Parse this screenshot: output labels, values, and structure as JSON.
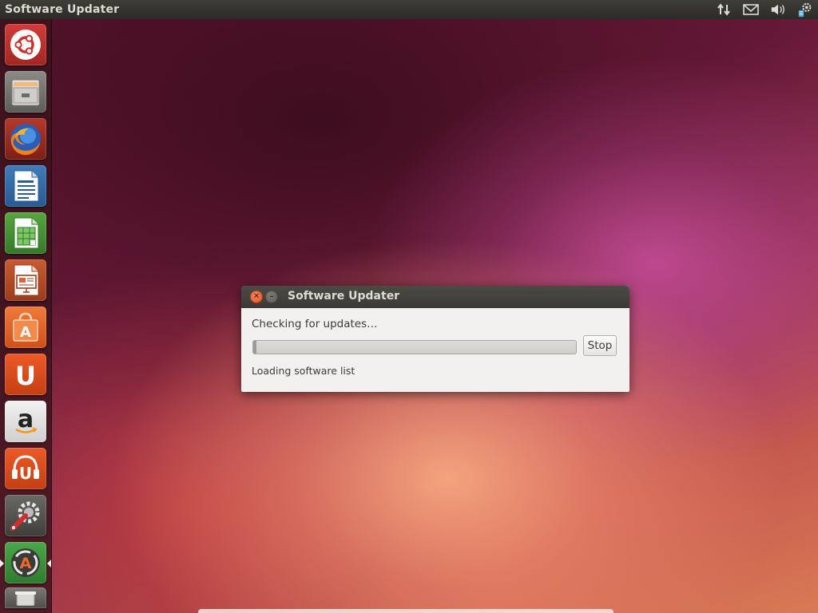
{
  "top_panel": {
    "title": "Software Updater",
    "indicators": [
      "network-icon",
      "mail-icon",
      "volume-icon",
      "settings-icon"
    ]
  },
  "launcher": {
    "items": [
      {
        "name": "dash-home",
        "icon": "ubuntu-logo-icon"
      },
      {
        "name": "files",
        "icon": "file-cabinet-icon"
      },
      {
        "name": "firefox",
        "icon": "firefox-icon"
      },
      {
        "name": "libreoffice-writer",
        "icon": "writer-doc-icon"
      },
      {
        "name": "libreoffice-calc",
        "icon": "calc-sheet-icon"
      },
      {
        "name": "libreoffice-impress",
        "icon": "impress-slide-icon"
      },
      {
        "name": "ubuntu-software-center",
        "icon": "shopping-bag-icon"
      },
      {
        "name": "ubuntu-one",
        "icon": "ubuntu-one-icon"
      },
      {
        "name": "amazon",
        "icon": "amazon-icon"
      },
      {
        "name": "ubuntu-one-music",
        "icon": "music-icon"
      },
      {
        "name": "system-settings",
        "icon": "wrench-gear-icon"
      },
      {
        "name": "software-updater",
        "icon": "updater-icon",
        "active": true
      },
      {
        "name": "trash",
        "icon": "trash-icon"
      }
    ],
    "amazon_letter": "a",
    "u_letter": "U",
    "a_letter": "A"
  },
  "dialog": {
    "title": "Software Updater",
    "status": "Checking for updates…",
    "stop_label": "Stop",
    "detail": "Loading software list",
    "progress_fraction": 0.0
  },
  "colors": {
    "panel": "#3c3b37",
    "close_button": "#e8522b",
    "dialog_bg": "#f2f1f0",
    "launcher_orange": "#e05420"
  }
}
